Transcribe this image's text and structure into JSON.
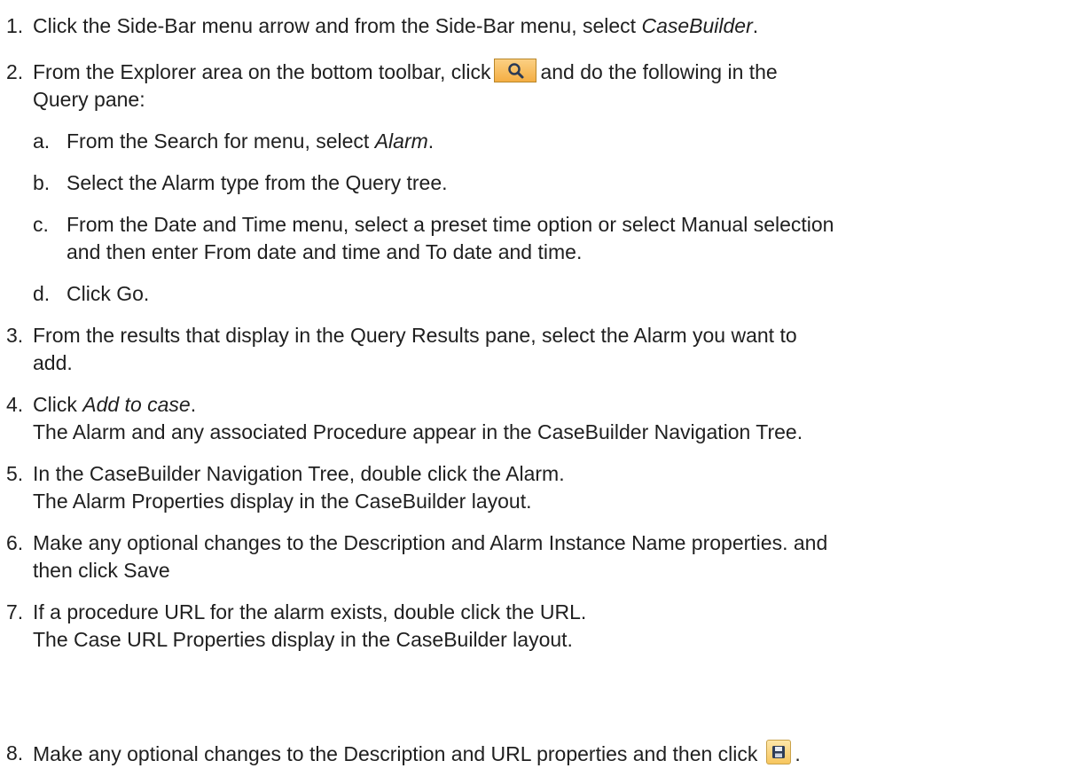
{
  "heading_fragment": "",
  "steps": [
    {
      "number": "1.",
      "text_before": "Click the Side-Bar menu arrow and from the Side-Bar menu, select ",
      "emphasis": "CaseBuilder",
      "text_after": "."
    },
    {
      "number": "2.",
      "text_before": "From the Explorer area on the bottom toolbar, click",
      "icon": "search-icon",
      "text_after_line1": "and do the following in the",
      "text_line2": "Query pane:",
      "substeps": [
        {
          "letter": "a.",
          "text_before": "From the Search for menu, select ",
          "emphasis": "Alarm",
          "text_after": "."
        },
        {
          "letter": "b.",
          "text": "Select the Alarm type from the Query tree."
        },
        {
          "letter": "c.",
          "line1": "From the Date and Time menu, select a preset time option or select Manual selection",
          "line2": "and then enter From date and time and To date and time."
        },
        {
          "letter": "d.",
          "text": "Click Go."
        }
      ]
    },
    {
      "number": "3.",
      "line1": "From the results that display in the Query Results pane, select the Alarm you want to",
      "line2": "add."
    },
    {
      "number": "4.",
      "text_before": "Click ",
      "emphasis": "Add to case",
      "text_after": ".",
      "line2": "The Alarm and any associated Procedure appear in the CaseBuilder Navigation Tree."
    },
    {
      "number": "5.",
      "line1": "In the CaseBuilder Navigation Tree, double click the Alarm.",
      "line2": "The Alarm Properties display in the CaseBuilder layout."
    },
    {
      "number": "6.",
      "line1": "Make any optional changes to the Description and Alarm Instance Name properties. and",
      "line2": "then click Save"
    },
    {
      "number": "7.",
      "line1": "If a procedure URL for the alarm exists, double click the URL.",
      "line2": "The Case URL Properties display in the CaseBuilder layout."
    },
    {
      "number": "8.",
      "text_before": "Make any optional changes to the Description and URL properties and then click",
      "icon": "save-icon",
      "text_after": "."
    }
  ],
  "colors": {
    "text": "#1f1f1f",
    "search_button": "#f4ae43",
    "save_button": "#f7c65e"
  }
}
